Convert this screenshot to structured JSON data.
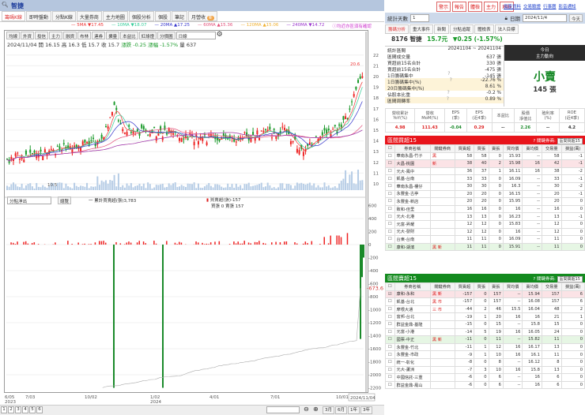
{
  "app": {
    "stock_title": "智捷"
  },
  "tabs": [
    {
      "label": "籌碼K線",
      "active": true
    },
    {
      "label": "即時盤動"
    },
    {
      "label": "分點K線"
    },
    {
      "label": "大量券商"
    },
    {
      "label": "主力地圖"
    },
    {
      "label": "個股分析"
    },
    {
      "label": "個股"
    },
    {
      "label": "筆記"
    },
    {
      "label": "月營收",
      "badge": "新"
    }
  ],
  "ma": [
    {
      "label": "5MA ▼17.45",
      "color": "#e33"
    },
    {
      "label": "10MA ▼18.07",
      "color": "#3c9"
    },
    {
      "label": "20MA ▲17.25",
      "color": "#33c"
    },
    {
      "label": "60MA ▲15.36",
      "color": "#e3507a"
    },
    {
      "label": "120MA ▲15.06",
      "color": "#f0b030"
    },
    {
      "label": "240MA ▼14.72",
      "color": "#93c"
    }
  ],
  "ma_note": "ⓘ均近亦區須有確認",
  "toolbar": {
    "buttons": [
      "均線",
      "外資",
      "投信",
      "主力",
      "融資",
      "布林",
      "連券",
      "擴量",
      "本益比",
      "紅綠燈",
      "分價圖"
    ],
    "period": "日線"
  },
  "quote": {
    "date": "2024/11/04",
    "open": "開 16.15",
    "high": "高 16.3",
    "low": "低 15.7",
    "close": "收 15.7",
    "change": "漲跌 -0.25",
    "pct": "漲幅 -1.57%",
    "vol": "量 637"
  },
  "price_axis": [
    "22",
    "21",
    "20",
    "19",
    "18",
    "17",
    "16",
    "15",
    "14",
    "13",
    "12",
    "11",
    "10"
  ],
  "price_high_label": "20.6",
  "price_low_label": "10.5",
  "lower": {
    "select": "分點淨出",
    "button": "總覽",
    "legend1": "一 累計買賣超(張)3,783",
    "legend2": "買賣超(張)-157",
    "legend3": "買張 0 賣張 157",
    "last_value": "-673.6",
    "axis": [
      "600",
      "400",
      "200",
      "0",
      "-200",
      "-400",
      "-600",
      "-800",
      "-1000",
      "-1200",
      "-1400",
      "-1600",
      "-1800",
      "-2000",
      "-2200"
    ]
  },
  "xaxis": [
    {
      "label": "6/05\n2023"
    },
    {
      "label": "7/03"
    },
    {
      "label": "10/02"
    },
    {
      "label": "1/02\n2024"
    },
    {
      "label": "4/01"
    },
    {
      "label": "7/01"
    },
    {
      "label": "10/01"
    }
  ],
  "xaxis_current": "2024/11/04",
  "pages": [
    "1",
    "2",
    "3",
    "4",
    "5",
    "6"
  ],
  "ranges": [
    "3月",
    "6月",
    "1年",
    "3年"
  ],
  "right": {
    "buttons": [
      "警示",
      "報告",
      "體檢",
      "主力",
      "地址"
    ],
    "links": [
      "個股資料",
      "交易驗證",
      "行事曆",
      "影音通知"
    ],
    "days_label": "統計天數",
    "days_value": "1",
    "date_label": "日期",
    "date_value": "2024/11/4",
    "today": "今天",
    "tabs": [
      "籌碼分析",
      "重大事件",
      "新聞",
      "分點追蹤",
      "體檢表",
      "法人目標"
    ],
    "stock": {
      "code_name": "8176 智捷",
      "price": "15.7元",
      "change": "▼0.25 (-1.57%)"
    },
    "stats": [
      {
        "k": "統計區間",
        "v": "20241104 ~ 20241104"
      },
      {
        "k": "區間成交量",
        "v": "637 張"
      },
      {
        "k": "買超前15名合計",
        "v": "330 張"
      },
      {
        "k": "賣超前15名合計",
        "v": "-475 張"
      },
      {
        "k": "1日籌碼集中",
        "v": "-145 張",
        "q": true
      },
      {
        "k": "1日籌碼集中(%)",
        "v": "-22.76 %",
        "q": true,
        "hl": true
      },
      {
        "k": "20日籌碼集中(%)",
        "v": "8.61 %",
        "hl": true
      },
      {
        "k": "佔股本比重",
        "v": "-0.2 %",
        "q": true
      },
      {
        "k": "區間周轉率",
        "v": "0.89 %",
        "q": true,
        "hl": true
      }
    ],
    "today_box": {
      "title": "今日",
      "subtitle": "主力動向",
      "action": "小賣",
      "amount": "145 張"
    },
    "metrics": {
      "headers": [
        "營收累計\nYoY(%)",
        "營收\nMoM(%)",
        "EPS\n(季)",
        "EPS\n(近4季)",
        "本益比",
        "股價\n淨值比",
        "殖利率\n(%)",
        "ROE\n(近4季)"
      ],
      "values": [
        "4.98",
        "111.43",
        "-0.04",
        "0.29",
        "--",
        "2.26",
        "--",
        "4.2"
      ]
    },
    "buy": {
      "title": "區間買超15",
      "key_label": "關鍵券商:",
      "key_select": "區間買超15",
      "color": "#e8141b",
      "headers": [
        "券商名稱",
        "關鍵券商",
        "買賣超",
        "買張",
        "賣張",
        "買均價",
        "賣均價",
        "交易量",
        "損益(萬)"
      ],
      "rows": [
        [
          "華南永昌-竹子",
          "黑",
          "58",
          "58",
          "0",
          "15.93",
          "--",
          "58",
          "-1"
        ],
        [
          "大昌-桃園",
          "新",
          "38",
          "40",
          "2",
          "15.98",
          "16",
          "42",
          "-1"
        ],
        [
          "元大-鳳中",
          "",
          "36",
          "37",
          "1",
          "16.11",
          "16",
          "38",
          "-2"
        ],
        [
          "凱基-台南",
          "",
          "33",
          "33",
          "0",
          "16.09",
          "--",
          "33",
          "-1"
        ],
        [
          "華南永昌-樓仔",
          "",
          "30",
          "30",
          "0",
          "16.3",
          "--",
          "30",
          "-2"
        ],
        [
          "永豐金-古亭",
          "",
          "20",
          "20",
          "0",
          "16.15",
          "--",
          "20",
          "-1"
        ],
        [
          "永豐金-新店",
          "",
          "20",
          "20",
          "0",
          "15.95",
          "--",
          "20",
          "0"
        ],
        [
          "致和-佳里",
          "",
          "16",
          "16",
          "0",
          "16",
          "--",
          "16",
          "0"
        ],
        [
          "元大-北港",
          "",
          "13",
          "13",
          "0",
          "16.23",
          "--",
          "13",
          "-1"
        ],
        [
          "元富-昇耀",
          "",
          "12",
          "12",
          "0",
          "15.83",
          "--",
          "12",
          "0"
        ],
        [
          "元大-發財",
          "",
          "12",
          "12",
          "0",
          "16",
          "--",
          "12",
          "0"
        ],
        [
          "台東-台南",
          "",
          "11",
          "11",
          "0",
          "16.09",
          "--",
          "11",
          "0"
        ],
        [
          "康和-湖濱",
          "黑 新",
          "11",
          "11",
          "0",
          "15.91",
          "--",
          "11",
          "0"
        ]
      ]
    },
    "sell": {
      "title": "區間賣超15",
      "key_label": "關鍵券商:",
      "key_select": "區間賣超15",
      "color": "#138a1e",
      "headers": [
        "券商名稱",
        "關鍵券商",
        "買賣超",
        "買張",
        "賣張",
        "買均價",
        "賣均價",
        "交易量",
        "損益(萬)"
      ],
      "rows": [
        [
          "康和-永和",
          "黑 新",
          "-157",
          "0",
          "157",
          "--",
          "15.94",
          "157",
          "6"
        ],
        [
          "凱基-台北",
          "黑 市",
          "-157",
          "0",
          "157",
          "--",
          "16.08",
          "157",
          "6"
        ],
        [
          "摩根大通",
          "三 市",
          "-44",
          "2",
          "46",
          "15.5",
          "16.04",
          "48",
          "2"
        ],
        [
          "富邦-台北",
          "",
          "-19",
          "1",
          "20",
          "16",
          "16",
          "21",
          "1"
        ],
        [
          "群益金鼎-基隆",
          "",
          "-15",
          "0",
          "15",
          "--",
          "15.8",
          "15",
          "0"
        ],
        [
          "元富-小港",
          "",
          "-14",
          "5",
          "19",
          "16",
          "16.05",
          "24",
          "0"
        ],
        [
          "國票-中正",
          "黑 新",
          "-11",
          "0",
          "11",
          "--",
          "15.82",
          "11",
          "0"
        ],
        [
          "永豐金-竹北",
          "",
          "-11",
          "1",
          "12",
          "16",
          "16.17",
          "13",
          "0"
        ],
        [
          "永豐金-市政",
          "",
          "-9",
          "1",
          "10",
          "16",
          "16.1",
          "11",
          "0"
        ],
        [
          "統一-彰化",
          "",
          "-8",
          "0",
          "8",
          "--",
          "16.12",
          "8",
          "0"
        ],
        [
          "元大-蘆洲",
          "",
          "-7",
          "3",
          "10",
          "16",
          "15.8",
          "13",
          "0"
        ],
        [
          "中國信託-三重",
          "",
          "-6",
          "0",
          "6",
          "--",
          "16",
          "6",
          "0"
        ],
        [
          "群益金鼎-鳳山",
          "",
          "-6",
          "0",
          "6",
          "--",
          "16",
          "6",
          "0"
        ]
      ]
    }
  }
}
